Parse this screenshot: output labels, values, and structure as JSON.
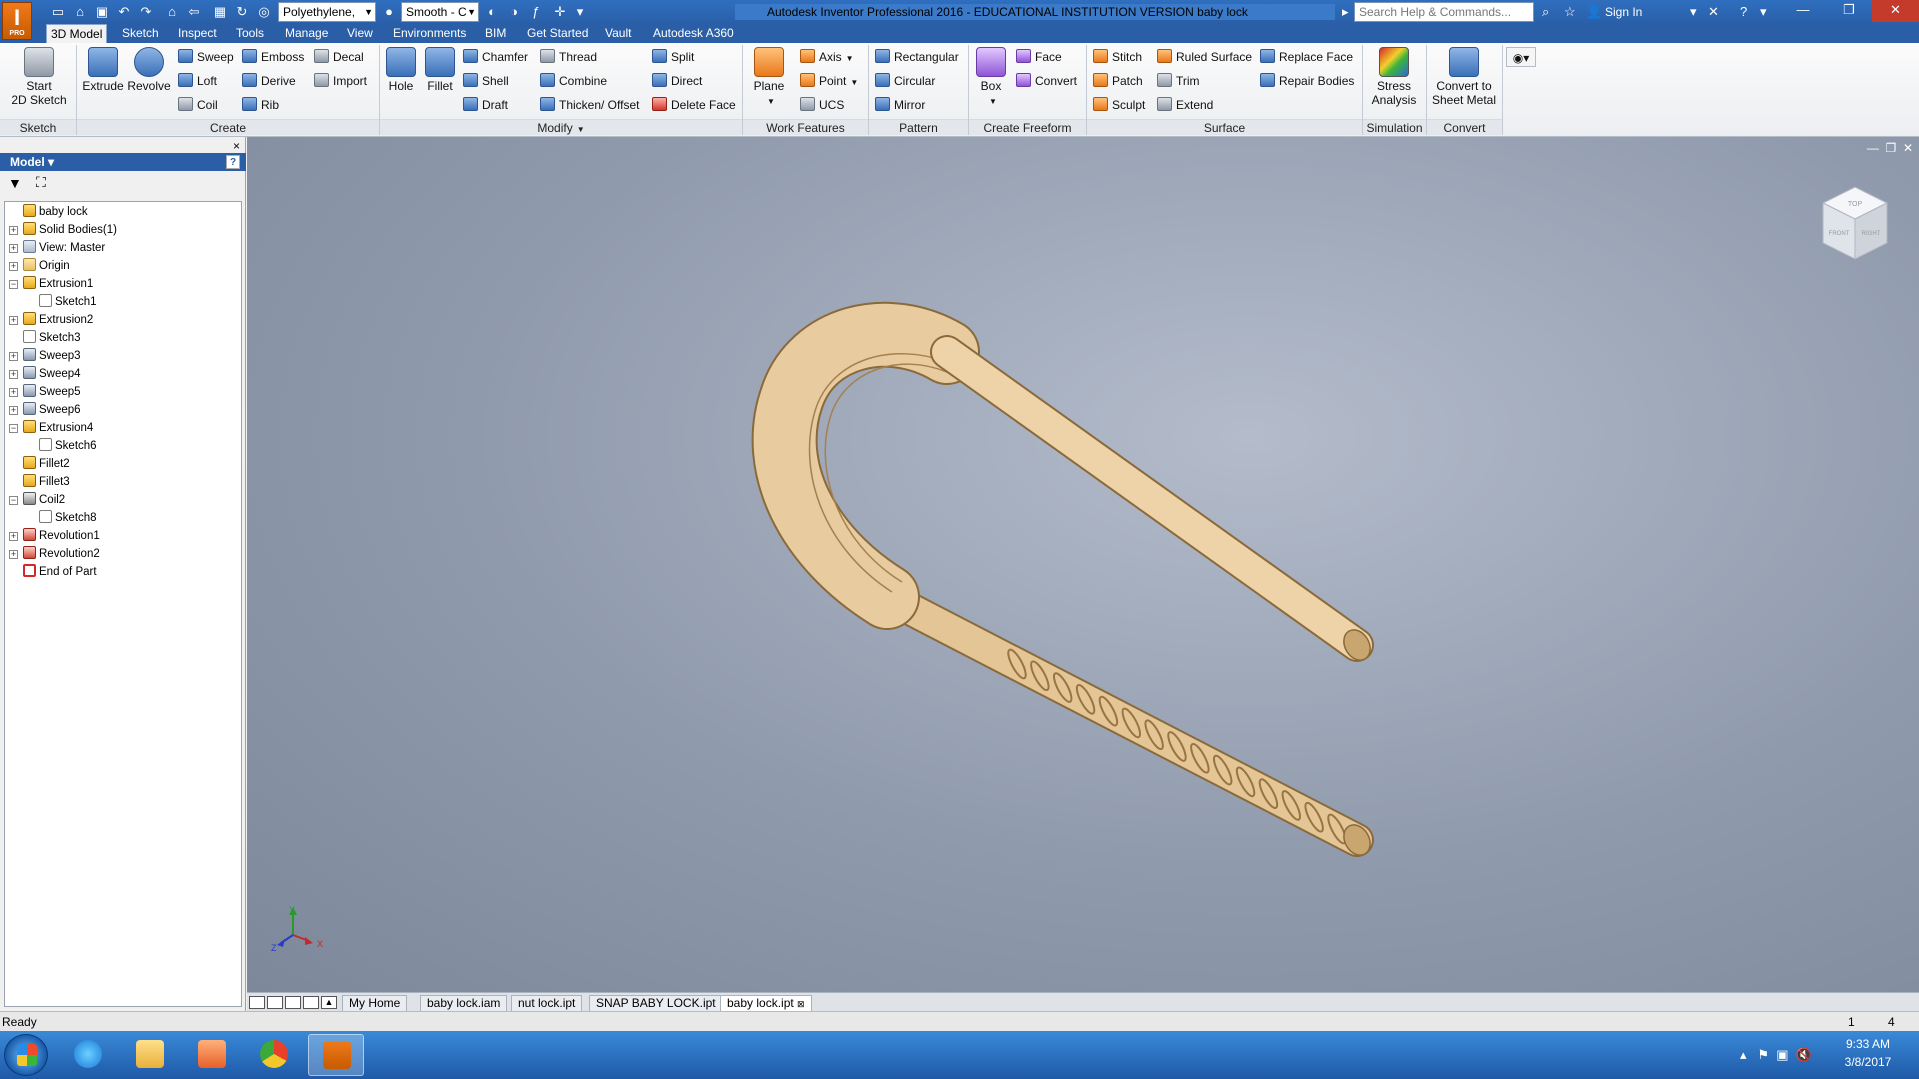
{
  "app": {
    "logo_letter": "I",
    "logo_badge": "PRO",
    "title": "Autodesk Inventor Professional 2016 - EDUCATIONAL INSTITUTION VERSION    baby lock",
    "search_placeholder": "Search Help & Commands...",
    "signin": "Sign In",
    "material": "Polyethylene,",
    "appearance": "Smooth - C"
  },
  "ribbon_tabs": [
    "3D Model",
    "Sketch",
    "Inspect",
    "Tools",
    "Manage",
    "View",
    "Environments",
    "BIM",
    "Get Started",
    "Vault",
    "Autodesk A360"
  ],
  "ribbon": {
    "sketch": {
      "title": "Sketch",
      "start": "Start",
      "start2": "2D Sketch"
    },
    "create": {
      "title": "Create",
      "extrude": "Extrude",
      "revolve": "Revolve",
      "sweep": "Sweep",
      "loft": "Loft",
      "coil": "Coil",
      "emboss": "Emboss",
      "derive": "Derive",
      "rib": "Rib",
      "decal": "Decal",
      "import": "Import"
    },
    "modify": {
      "title": "Modify",
      "hole": "Hole",
      "fillet": "Fillet",
      "chamfer": "Chamfer",
      "shell": "Shell",
      "draft": "Draft",
      "thread": "Thread",
      "combine": "Combine",
      "thicken": "Thicken/ Offset",
      "split": "Split",
      "direct": "Direct",
      "delete_face": "Delete Face"
    },
    "work": {
      "title": "Work Features",
      "plane": "Plane",
      "axis": "Axis",
      "point": "Point",
      "ucs": "UCS"
    },
    "pattern": {
      "title": "Pattern",
      "rectangular": "Rectangular",
      "circular": "Circular",
      "mirror": "Mirror"
    },
    "freeform": {
      "title": "Create Freeform",
      "box": "Box",
      "face": "Face",
      "convert": "Convert"
    },
    "surface": {
      "title": "Surface",
      "stitch": "Stitch",
      "patch": "Patch",
      "sculpt": "Sculpt",
      "ruled": "Ruled Surface",
      "trim": "Trim",
      "extend": "Extend",
      "replace_face": "Replace Face",
      "repair_bodies": "Repair Bodies"
    },
    "simulation": {
      "title": "Simulation",
      "stress": "Stress",
      "stress2": "Analysis"
    },
    "convert": {
      "title": "Convert",
      "sheet": "Convert to",
      "sheet2": "Sheet Metal"
    }
  },
  "browser": {
    "title": "Model",
    "help": "?",
    "close": "×",
    "tree": [
      {
        "label": "baby lock",
        "icon": "part",
        "level": 0,
        "exp": "none"
      },
      {
        "label": "Solid Bodies(1)",
        "icon": "solid",
        "level": 0,
        "exp": "+"
      },
      {
        "label": "View: Master",
        "icon": "view",
        "level": 0,
        "exp": "+"
      },
      {
        "label": "Origin",
        "icon": "folder",
        "level": 0,
        "exp": "+"
      },
      {
        "label": "Extrusion1",
        "icon": "extrude",
        "level": 0,
        "exp": "-"
      },
      {
        "label": "Sketch1",
        "icon": "sketch",
        "level": 1,
        "exp": "none"
      },
      {
        "label": "Extrusion2",
        "icon": "extrude",
        "level": 0,
        "exp": "+"
      },
      {
        "label": "Sketch3",
        "icon": "sketch",
        "level": 0,
        "exp": "none"
      },
      {
        "label": "Sweep3",
        "icon": "sweep",
        "level": 0,
        "exp": "+"
      },
      {
        "label": "Sweep4",
        "icon": "sweep",
        "level": 0,
        "exp": "+"
      },
      {
        "label": "Sweep5",
        "icon": "sweep",
        "level": 0,
        "exp": "+"
      },
      {
        "label": "Sweep6",
        "icon": "sweep",
        "level": 0,
        "exp": "+"
      },
      {
        "label": "Extrusion4",
        "icon": "extrude",
        "level": 0,
        "exp": "-"
      },
      {
        "label": "Sketch6",
        "icon": "sketch",
        "level": 1,
        "exp": "none"
      },
      {
        "label": "Fillet2",
        "icon": "extrude",
        "level": 0,
        "exp": "none"
      },
      {
        "label": "Fillet3",
        "icon": "extrude",
        "level": 0,
        "exp": "none"
      },
      {
        "label": "Coil2",
        "icon": "coil",
        "level": 0,
        "exp": "-"
      },
      {
        "label": "Sketch8",
        "icon": "sketch",
        "level": 1,
        "exp": "none"
      },
      {
        "label": "Revolution1",
        "icon": "revolve",
        "level": 0,
        "exp": "+"
      },
      {
        "label": "Revolution2",
        "icon": "revolve",
        "level": 0,
        "exp": "+"
      },
      {
        "label": "End of Part",
        "icon": "end",
        "level": 0,
        "exp": "none"
      }
    ]
  },
  "viewcube": {
    "top": "TOP",
    "front": "FRONT",
    "right": "RIGHT"
  },
  "triad": {
    "x": "X",
    "y": "Y",
    "z": "Z"
  },
  "doc_tabs": [
    {
      "label": "My Home",
      "active": false
    },
    {
      "label": "baby lock.iam",
      "active": false
    },
    {
      "label": "nut lock.ipt",
      "active": false
    },
    {
      "label": "SNAP BABY LOCK.ipt",
      "active": false
    },
    {
      "label": "baby lock.ipt",
      "active": true
    }
  ],
  "status": {
    "text": "Ready",
    "n1": "1",
    "n2": "4"
  },
  "taskbar": {
    "time": "9:33 AM",
    "date": "3/8/2017"
  },
  "colors": {
    "model": "#e8c99a",
    "edge": "#8a6a3a",
    "ribbon_blue": "#2a5fa8"
  }
}
